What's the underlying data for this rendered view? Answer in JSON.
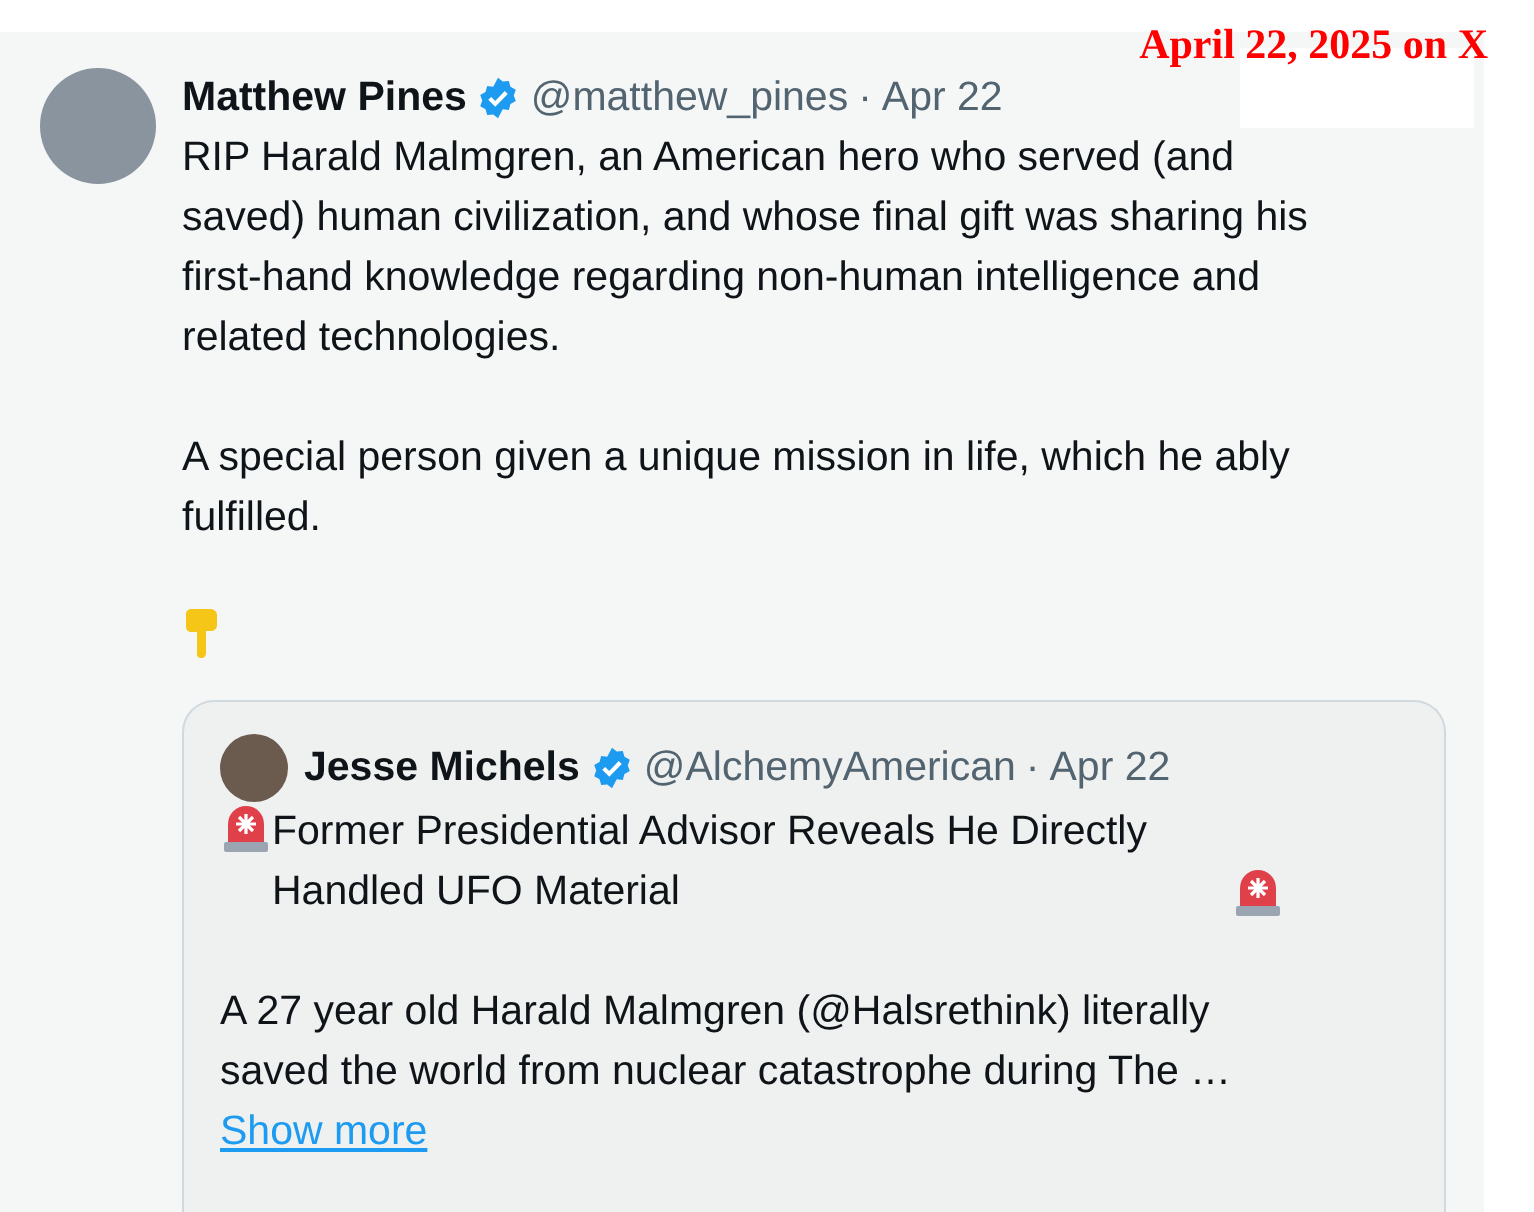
{
  "annotation": "April 22, 2025 on X",
  "post": {
    "author": "Matthew Pines",
    "verified": true,
    "handle": "@matthew_pines",
    "separator": "·",
    "date": "Apr 22",
    "paragraphs": [
      "RIP Harald Malmgren, an American hero who served (and saved) human civilization, and whose final gift was sharing his first-hand knowledge regarding non-human intelligence and related technologies.",
      "A special person given a unique mission in life, which he ably fulfilled."
    ],
    "quoted_post": {
      "author": "Jesse Michels",
      "verified": true,
      "handle": "@AlchemyAmerican",
      "separator": "·",
      "date": "Apr 22",
      "headline": "Former Presidential Advisor Reveals He Directly Handled UFO Material",
      "body": "A 27 year old Harald Malmgren (@Halsrethink) literally saved the world from nuclear catastrophe during The …",
      "show_more": "Show more"
    }
  }
}
